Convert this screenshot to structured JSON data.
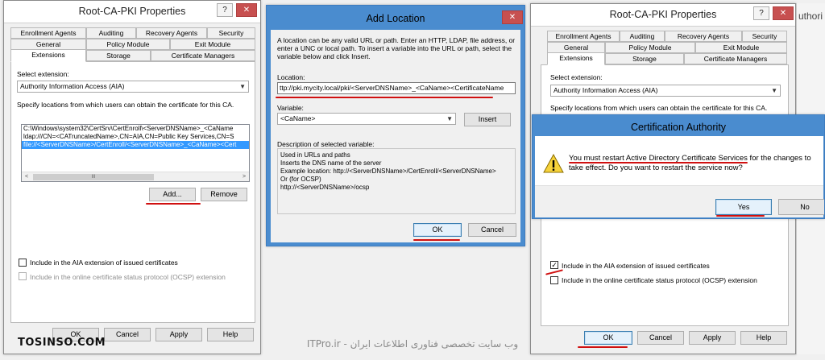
{
  "left_window": {
    "title": "Root-CA-PKI Properties",
    "help_btn": "?",
    "close_btn": "✕",
    "tabs_row1": [
      "Enrollment Agents",
      "Auditing",
      "Recovery Agents",
      "Security"
    ],
    "tabs_row2": [
      "General",
      "Policy Module",
      "Exit Module"
    ],
    "tabs_row3": [
      "Extensions",
      "Storage",
      "Certificate Managers"
    ],
    "select_extension_label": "Select extension:",
    "select_extension_value": "Authority Information Access (AIA)",
    "specify_label": "Specify locations from which users can obtain the certificate for this CA.",
    "locations": [
      "C:\\Windows\\system32\\CertSrv\\CertEnroll\\<ServerDNSName>_<CaName",
      "ldap:///CN=<CATruncatedName>,CN=AIA,CN=Public Key Services,CN=S",
      "file://<ServerDNSName>/CertEnroll/<ServerDNSName>_<CaName><Cert"
    ],
    "scroll_left": "<",
    "scroll_right": ">",
    "scroll_thumb": "III",
    "add_btn": "Add...",
    "remove_btn": "Remove",
    "cb_include_aia": "Include in the AIA extension of issued certificates",
    "cb_include_ocsp": "Include in the online certificate status protocol (OCSP) extension",
    "ok": "OK",
    "cancel": "Cancel",
    "apply": "Apply",
    "help": "Help"
  },
  "middle_window": {
    "title": "Add Location",
    "close_btn": "✕",
    "intro": "A location can be any valid URL or path. Enter an HTTP, LDAP, file address, or enter a UNC or local path. To insert a variable into the URL or path, select the variable below and click Insert.",
    "location_label": "Location:",
    "location_value": "ttp://pki.mycity.local/pki/<ServerDNSName>_<CaName><CertificateName",
    "variable_label": "Variable:",
    "variable_value": "<CaName>",
    "insert_btn": "Insert",
    "description_label": "Description of selected variable:",
    "description_lines": [
      "Used in URLs and paths",
      "Inserts the DNS name of the server",
      "Example location: http://<ServerDNSName>/CertEnroll/<ServerDNSName>",
      "Or (for OCSP)",
      "http://<ServerDNSName>/ocsp"
    ],
    "ok": "OK",
    "cancel": "Cancel"
  },
  "right_window": {
    "title": "Root-CA-PKI Properties",
    "help_btn": "?",
    "close_btn": "✕",
    "peek_text": "uthori",
    "tabs_row1": [
      "Enrollment Agents",
      "Auditing",
      "Recovery Agents",
      "Security"
    ],
    "tabs_row2": [
      "General",
      "Policy Module",
      "Exit Module"
    ],
    "tabs_row3": [
      "Extensions",
      "Storage",
      "Certificate Managers"
    ],
    "select_extension_label": "Select extension:",
    "select_extension_value": "Authority Information Access (AIA)",
    "specify_label": "Specify locations from which users can obtain the certificate for this CA.",
    "cb_include_aia": "Include in the AIA extension of issued certificates",
    "cb_include_ocsp": "Include in the online certificate status protocol (OCSP) extension",
    "ok": "OK",
    "cancel": "Cancel",
    "apply": "Apply",
    "help": "Help"
  },
  "ca_dialog": {
    "title": "Certification Authority",
    "message_line1": "You must restart Active Directory Certificate Services for the changes to",
    "message_line2": "take effect. Do you want to restart the service now?",
    "yes": "Yes",
    "no": "No"
  },
  "watermark_left": "TOSINSO.COM",
  "watermark_center": "ITPro.ir - وب سایت تخصصی فناوری اطلاعات ایران",
  "colors": {
    "annotation_red": "#d01010",
    "selection_blue": "#3399ff",
    "close_red": "#c75050"
  }
}
